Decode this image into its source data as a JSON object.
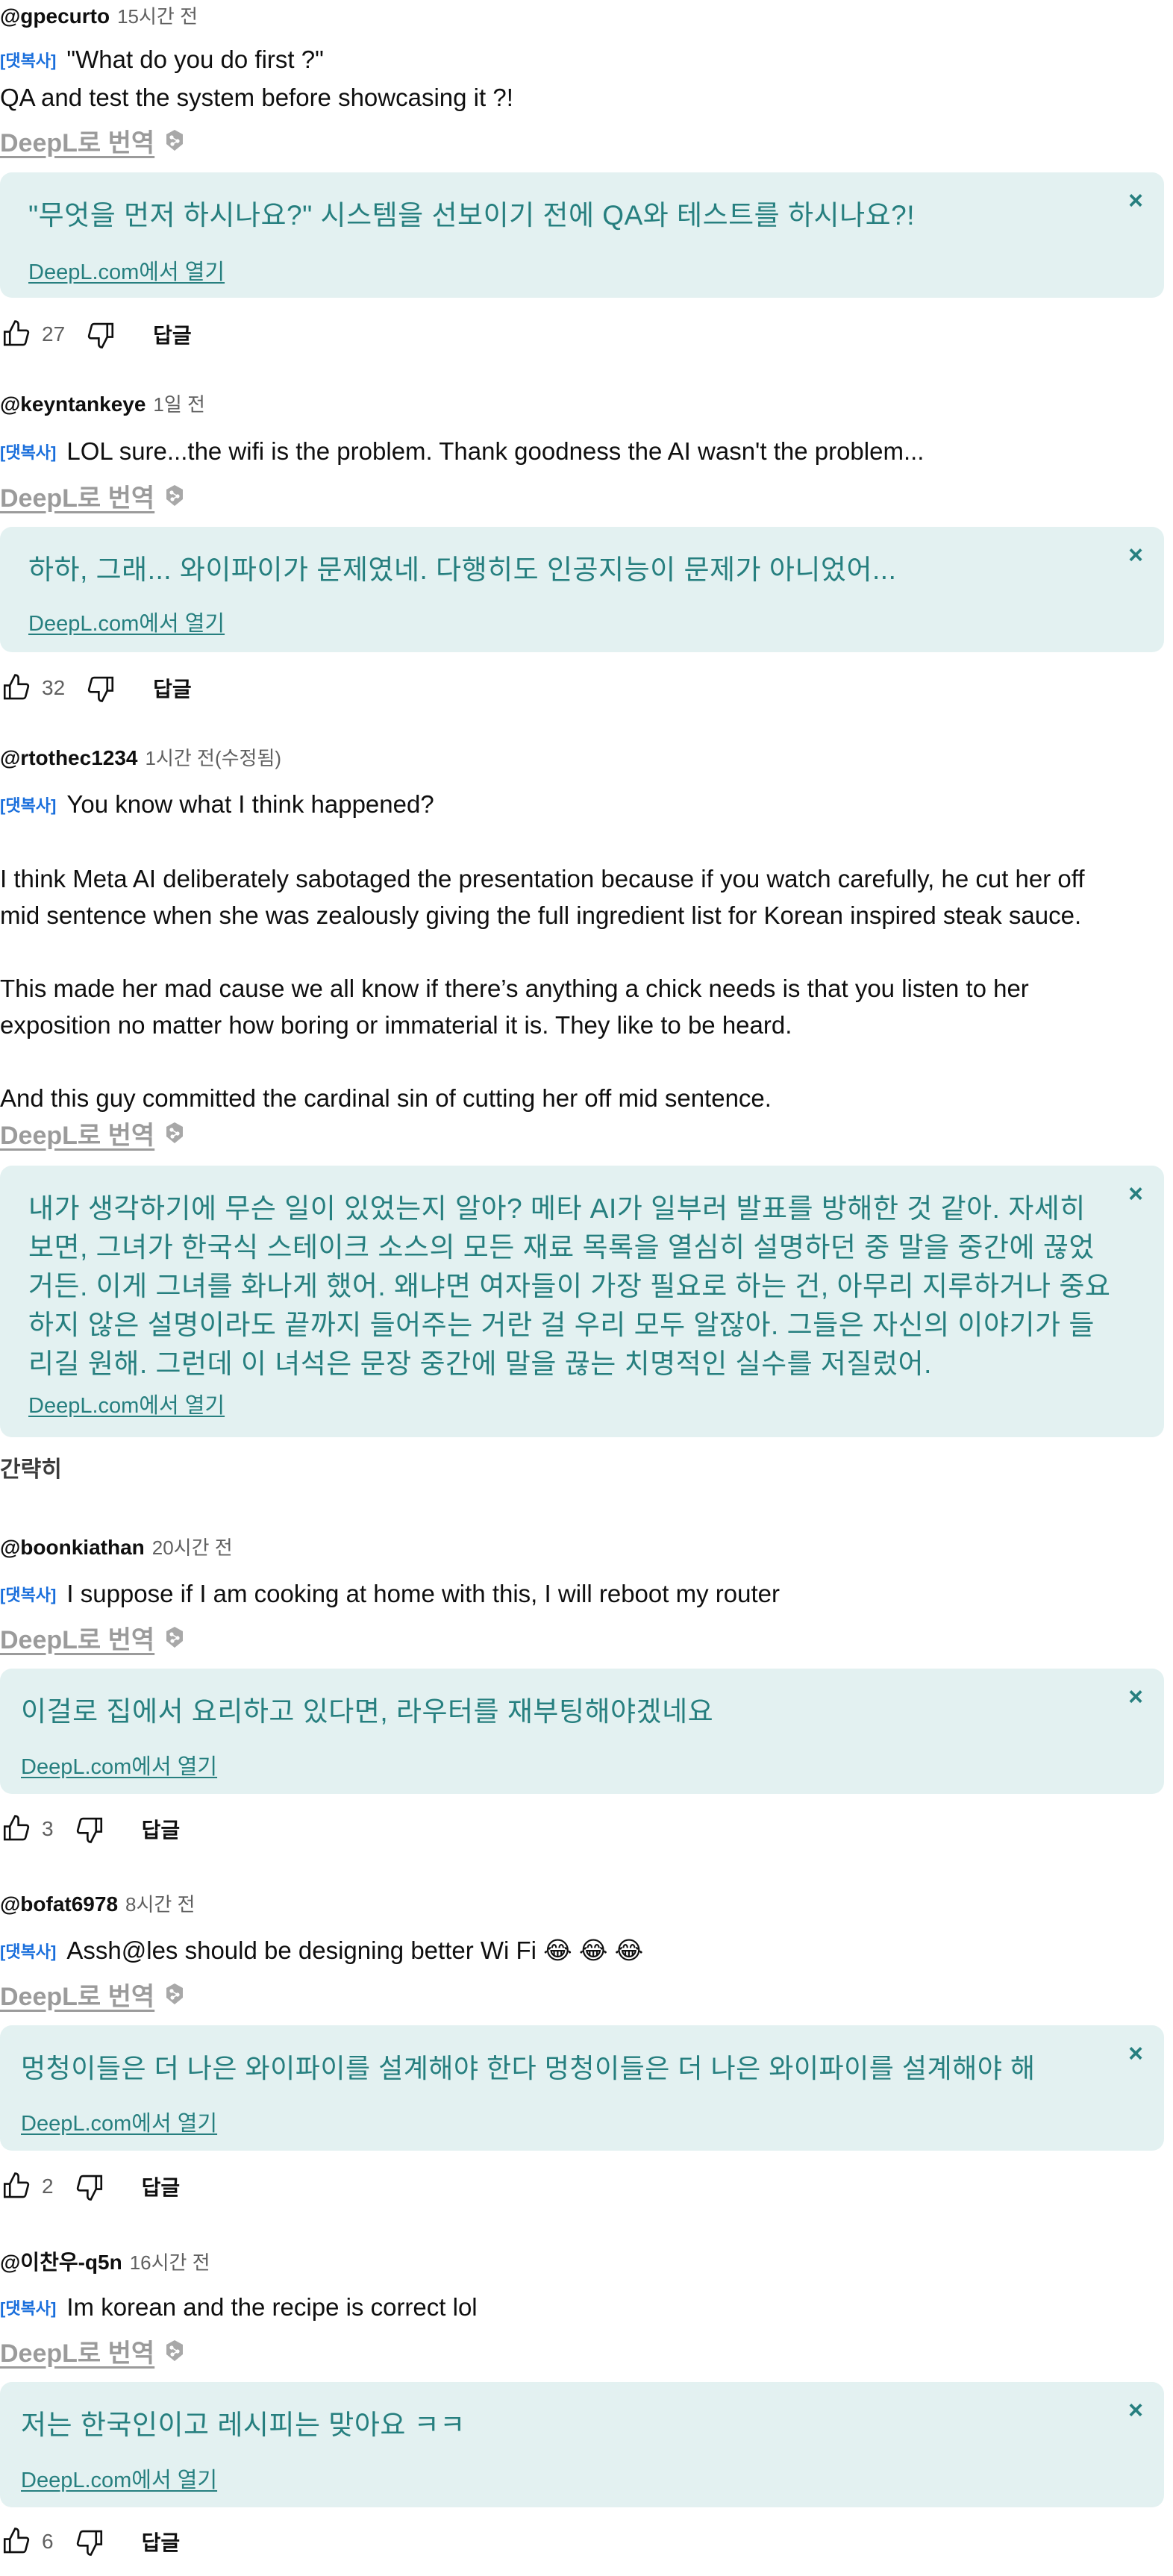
{
  "ui": {
    "tag_label": "[댓복사]",
    "deepl_link_label": "DeepL로 번역",
    "deepl_open_label": "DeepL.com에서 열기",
    "reply_label": "답글",
    "summary_label": "간략히",
    "close_glyph": "×"
  },
  "colors": {
    "accent_teal": "#267f7f",
    "translation_bg": "#e3f1f1",
    "tag_blue": "#1a6fdc",
    "muted_gray": "#606060"
  },
  "comments": [
    {
      "author": "@gpecurto",
      "time": "15시간 전",
      "text": "\"What do you do first ?\"\nQA and test the system before showcasing it ?!",
      "translation": "\"무엇을 먼저 하시나요?\" 시스템을 선보이기 전에 QA와 테스트를 하시나요?!",
      "likes": "27"
    },
    {
      "author": "@keyntankeye",
      "time": "1일 전",
      "text": "LOL sure...the wifi is the problem. Thank goodness the AI wasn't the problem...",
      "translation": "하하, 그래... 와이파이가 문제였네. 다행히도 인공지능이 문제가 아니었어...",
      "likes": "32"
    },
    {
      "author": "@rtothec1234",
      "time": "1시간 전(수정됨)",
      "text": "You know what I think happened?\n\nI think Meta AI deliberately sabotaged the presentation because if you watch carefully, he cut her off\nmid sentence when she was zealously giving the full ingredient list for Korean inspired steak sauce.\n\nThis made her mad cause we all know if there’s anything a chick needs is that you listen to her\nexposition no matter how boring or immaterial it is. They like to be heard.\n\nAnd this guy committed the cardinal sin of cutting her off mid sentence.",
      "translation": "내가 생각하기에 무슨 일이 있었는지 알아? 메타 AI가 일부러 발표를 방해한 것 같아. 자세히 보면, 그녀가 한국식 스테이크 소스의 모든 재료 목록을 열심히 설명하던 중 말을 중간에 끊었거든. 이게 그녀를 화나게 했어. 왜냐면 여자들이 가장 필요로 하는 건, 아무리 지루하거나 중요하지 않은 설명이라도 끝까지 들어주는 거란 걸 우리 모두 알잖아. 그들은 자신의 이야기가 들리길 원해. 그런데 이 녀석은 문장 중간에 말을 끊는 치명적인 실수를 저질렀어.",
      "likes": ""
    },
    {
      "author": "@boonkiathan",
      "time": "20시간 전",
      "text": "I suppose if I am cooking at home with this, I will reboot my router",
      "translation": "이걸로 집에서 요리하고 있다면, 라우터를 재부팅해야겠네요",
      "likes": "3"
    },
    {
      "author": "@bofat6978",
      "time": "8시간 전",
      "text": "Assh@les should be designing better Wi Fi 😂 😂 😂",
      "translation": "멍청이들은 더 나은 와이파이를 설계해야 한다 멍청이들은 더 나은 와이파이를 설계해야 해",
      "likes": "2"
    },
    {
      "author": "@이찬우-q5n",
      "time": "16시간 전",
      "text": "Im korean and the recipe is correct lol",
      "translation": "저는 한국인이고 레시피는 맞아요 ㅋㅋ",
      "likes": "6"
    }
  ]
}
